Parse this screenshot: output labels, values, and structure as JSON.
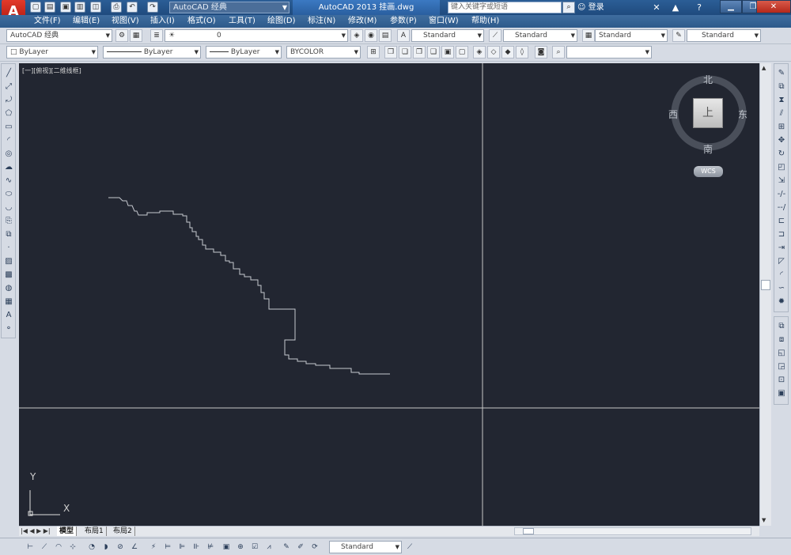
{
  "titlebar": {
    "workspace": "AutoCAD 经典",
    "title": "AutoCAD 2013    挂画.dwg",
    "search_placeholder": "键入关键字或短语",
    "login": "登录",
    "help": "?"
  },
  "menu": [
    "文件(F)",
    "编辑(E)",
    "视图(V)",
    "插入(I)",
    "格式(O)",
    "工具(T)",
    "绘图(D)",
    "标注(N)",
    "修改(M)",
    "参数(P)",
    "窗口(W)",
    "帮助(H)"
  ],
  "toolbar1": {
    "workspace": "AutoCAD 经典",
    "layer": "0",
    "text_style": "Standard",
    "dim_style": "Standard",
    "table_style": "Standard",
    "multileader_style": "Standard"
  },
  "toolbar2": {
    "color": "ByLayer",
    "linetype": "ByLayer",
    "lineweight": "ByLayer",
    "plotstyle": "BYCOLOR"
  },
  "viewport": {
    "label": "[一][俯视][二维线框]",
    "compass_n": "北",
    "compass_s": "南",
    "compass_w": "西",
    "compass_e": "东",
    "cube_face": "上",
    "wcs": "WCS",
    "ucs_y": "Y",
    "ucs_x": "X"
  },
  "layout_tabs": [
    "模型",
    "布局1",
    "布局2"
  ],
  "status": {
    "annotation_scale": "Standard"
  },
  "colors": {
    "canvas_bg": "#222631",
    "crosshair": "#c8c8c8",
    "polyline": "#c6c9d0",
    "titlebar": "#2b5e96"
  },
  "icons": {
    "app": "autocad-logo",
    "quick_access": [
      "new-icon",
      "open-icon",
      "save-icon",
      "saveas-icon",
      "print-icon",
      "plot-preview-icon",
      "undo-icon",
      "redo-icon"
    ],
    "draw": [
      "line-icon",
      "xline-icon",
      "polyline-icon",
      "polygon-icon",
      "rectangle-icon",
      "arc-icon",
      "circle-icon",
      "revcloud-icon",
      "spline-icon",
      "ellipse-icon",
      "ellipse-arc-icon",
      "insert-block-icon",
      "make-block-icon",
      "point-icon",
      "hatch-icon",
      "gradient-icon",
      "region-icon",
      "table-icon",
      "mtext-icon",
      "add-selected-icon"
    ],
    "modify": [
      "erase-icon",
      "copy-icon",
      "mirror-icon",
      "offset-icon",
      "array-icon",
      "move-icon",
      "rotate-icon",
      "scale-icon",
      "stretch-icon",
      "trim-icon",
      "extend-icon",
      "break-point-icon",
      "break-icon",
      "join-icon",
      "chamfer-icon",
      "fillet-icon",
      "blend-icon",
      "explode-icon"
    ]
  }
}
